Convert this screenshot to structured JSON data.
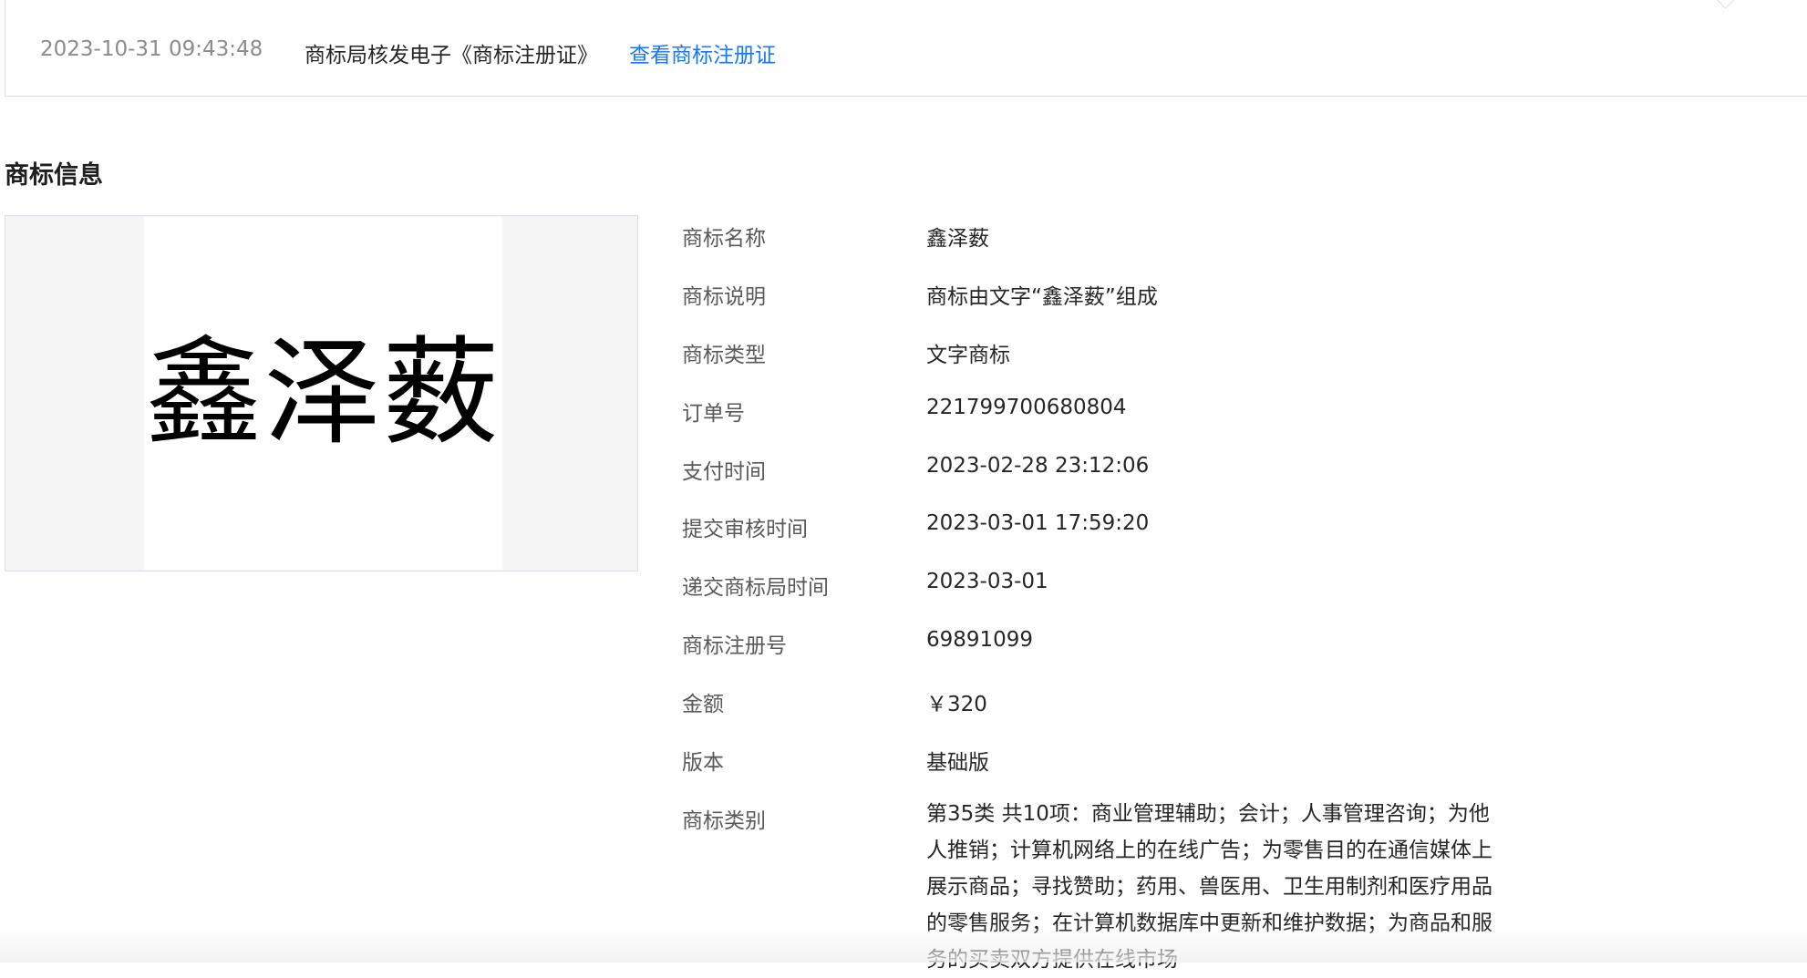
{
  "notice": {
    "timestamp": "2023-10-31 09:43:48",
    "message": "商标局核发电子《商标注册证》",
    "link_label": "查看商标注册证"
  },
  "section": {
    "title": "商标信息"
  },
  "trademark_image": {
    "text": "鑫泽薮"
  },
  "info": {
    "name": {
      "label": "商标名称",
      "value": "鑫泽薮"
    },
    "description": {
      "label": "商标说明",
      "value": "商标由文字“鑫泽薮”组成"
    },
    "type": {
      "label": "商标类型",
      "value": "文字商标"
    },
    "order_no": {
      "label": "订单号",
      "value": "221799700680804"
    },
    "pay_time": {
      "label": "支付时间",
      "value": "2023-02-28 23:12:06"
    },
    "submit_time": {
      "label": "提交审核时间",
      "value": "2023-03-01 17:59:20"
    },
    "office_time": {
      "label": "递交商标局时间",
      "value": "2023-03-01"
    },
    "reg_no": {
      "label": "商标注册号",
      "value": "69891099"
    },
    "amount": {
      "label": "金额",
      "value": "￥320"
    },
    "version": {
      "label": "版本",
      "value": "基础版"
    },
    "category": {
      "label": "商标类别",
      "value": "第35类 共10项：商业管理辅助；会计；人事管理咨询；为他人推销；计算机网络上的在线广告；为零售目的在通信媒体上展示商品；寻找赞助；药用、兽医用、卫生用制剂和医疗用品的零售服务；在计算机数据库中更新和维护数据；为商品和服务的买卖双方提供在线市场"
    }
  },
  "colors": {
    "link": "#1677ff",
    "border": "#dcdfe6",
    "muted_text": "#8c8c8c",
    "label_text": "#595959",
    "value_text": "#262626"
  }
}
